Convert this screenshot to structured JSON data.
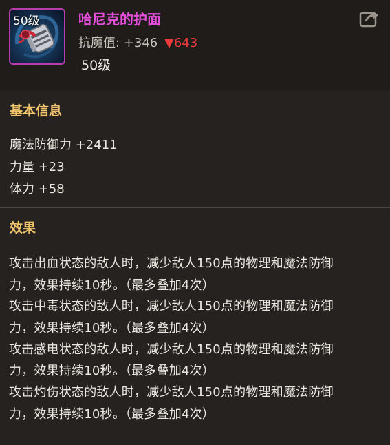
{
  "item": {
    "level_badge": "50级",
    "name": "哈尼克的护面",
    "resist_label": "抗魔值:",
    "resist_value": "+346",
    "resist_diff_arrow": "▼",
    "resist_diff": "643",
    "required_level": "50级",
    "icon_name": "helmet-mask-icon",
    "rarity_color": "#b83bb0"
  },
  "basic_info": {
    "title": "基本信息",
    "stats": [
      "魔法防御力 +2411",
      "力量 +23",
      "体力 +58"
    ]
  },
  "effect": {
    "title": "效果",
    "lines": [
      "攻击出血状态的敌人时，减少敌人150点的物理和魔法防御",
      "力，效果持续10秒。（最多叠加4次）",
      "攻击中毒状态的敌人时，减少敌人150点的物理和魔法防御",
      "力，效果持续10秒。（最多叠加4次）",
      "攻击感电状态的敌人时，减少敌人150点的物理和魔法防御",
      "力，效果持续10秒。（最多叠加4次）",
      "攻击灼伤状态的敌人时，减少敌人150点的物理和魔法防御",
      "力，效果持续10秒。（最多叠加4次）"
    ]
  },
  "colors": {
    "name": "#e44fd8",
    "section_title": "#f0c46c",
    "diff_down": "#e83a3a"
  },
  "share_icon": "share-icon"
}
